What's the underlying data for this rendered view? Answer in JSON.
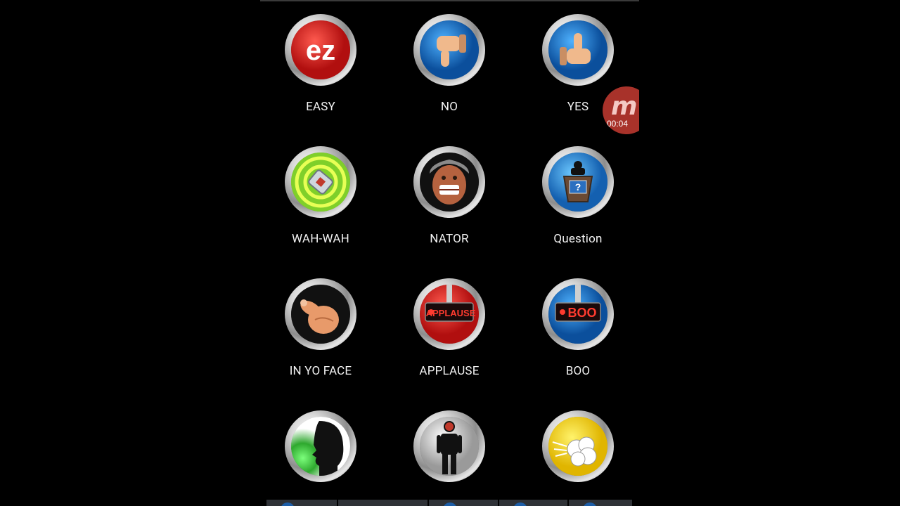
{
  "soundboard": {
    "buttons": [
      {
        "label": "EASY",
        "icon": "ez-logo-icon"
      },
      {
        "label": "NO",
        "icon": "thumbs-down-icon"
      },
      {
        "label": "YES",
        "icon": "thumbs-up-icon"
      },
      {
        "label": "WAH-WAH",
        "icon": "trumpet-mute-icon"
      },
      {
        "label": "NATOR",
        "icon": "screaming-face-icon"
      },
      {
        "label": "Question",
        "icon": "podium-question-icon"
      },
      {
        "label": "IN YO FACE",
        "icon": "pointing-finger-icon"
      },
      {
        "label": "APPLAUSE",
        "icon": "applause-sign-icon"
      },
      {
        "label": "BOO",
        "icon": "boo-sign-icon"
      },
      {
        "label": "",
        "icon": "silhouette-head-icon"
      },
      {
        "label": "",
        "icon": "standing-man-icon"
      },
      {
        "label": "",
        "icon": "fart-cloud-icon"
      }
    ]
  },
  "ez_text": "ez",
  "applause_text": "APPLAUSE",
  "boo_text": "BOO",
  "question_mark": "?",
  "recorder": {
    "logo": "m",
    "time": "00:04"
  }
}
